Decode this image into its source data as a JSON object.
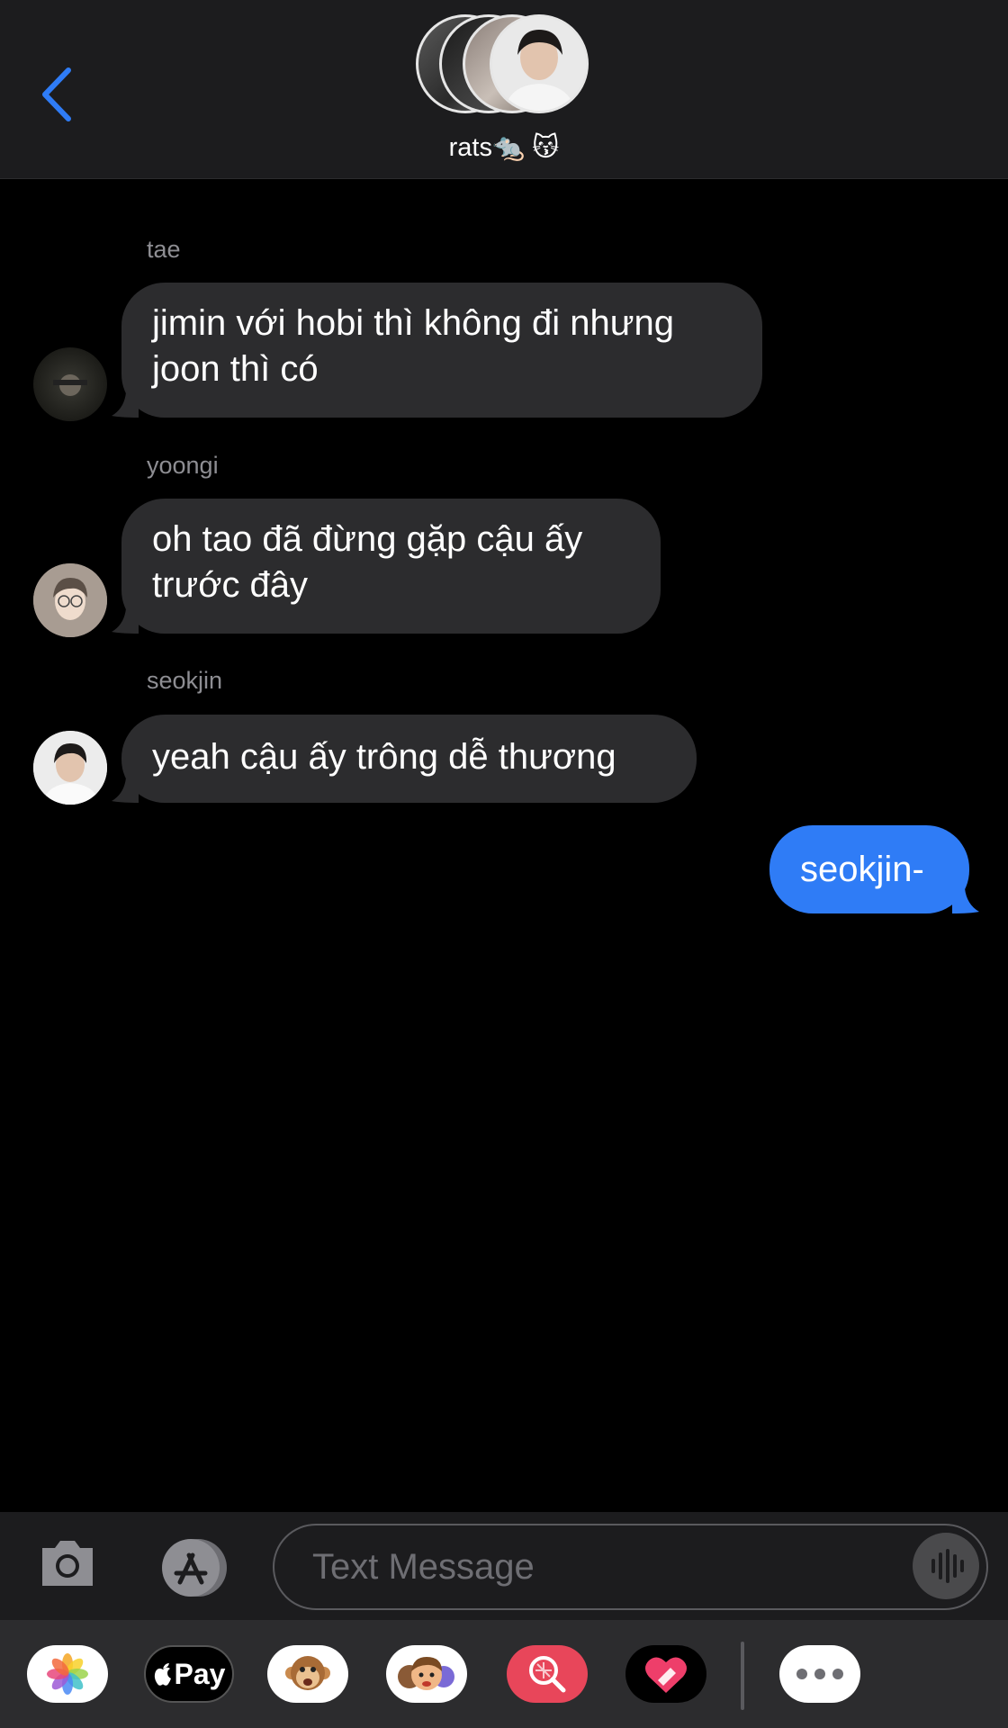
{
  "header": {
    "group_name": "rats🐀 😽",
    "member_avatars": [
      "member-avatar-1",
      "member-avatar-2",
      "member-avatar-3"
    ]
  },
  "messages": [
    {
      "sender": "tae",
      "text_lines": [
        "jimin với hobi thì không đi nhưng",
        "joon thì có"
      ]
    },
    {
      "sender": "yoongi",
      "text_lines": [
        "oh tao đã đừng gặp cậu ấy",
        "trước đây"
      ]
    },
    {
      "sender": "seokjin",
      "text_lines": [
        "yeah cậu ấy trông dễ thương"
      ]
    }
  ],
  "outgoing": {
    "text": "seokjin-"
  },
  "composer": {
    "placeholder": "Text Message"
  },
  "app_drawer": {
    "items": [
      "photos-app-icon",
      "apple-pay-icon",
      "animoji-monkey-icon",
      "memoji-icon",
      "search-images-icon",
      "digital-touch-icon",
      "more-apps-icon"
    ],
    "apple_pay_label": "Pay"
  },
  "colors": {
    "accent": "#2f7cf6",
    "incoming_bubble": "#2c2c2e",
    "header_bg": "#1c1c1e",
    "background": "#000000"
  }
}
